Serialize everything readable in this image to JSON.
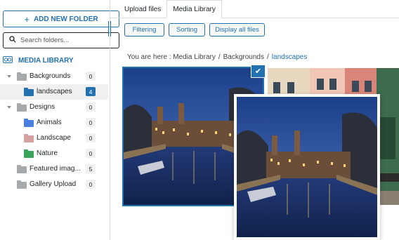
{
  "sidebar": {
    "add_folder_label": "ADD NEW FOLDER",
    "search_placeholder": "Search folders...",
    "library_label": "MEDIA LIBRARY",
    "folders": [
      {
        "label": "Backgrounds",
        "count": "0",
        "color": "#a7aaad"
      },
      {
        "label": "landscapes",
        "count": "4",
        "color": "#2271b1"
      },
      {
        "label": "Designs",
        "count": "0",
        "color": "#a7aaad"
      },
      {
        "label": "Animals",
        "count": "0",
        "color": "#4a7fe0"
      },
      {
        "label": "Landscape",
        "count": "0",
        "color": "#d4a0a0"
      },
      {
        "label": "Nature",
        "count": "0",
        "color": "#3aa35a"
      },
      {
        "label": "Featured imag...",
        "count": "5",
        "color": "#a7aaad"
      },
      {
        "label": "Gallery Upload",
        "count": "0",
        "color": "#a7aaad"
      }
    ]
  },
  "tabs": [
    {
      "label": "Upload files"
    },
    {
      "label": "Media Library"
    }
  ],
  "toolbar": {
    "filtering": "Filtering",
    "sorting": "Sorting",
    "display_all": "Display all files"
  },
  "breadcrumb": {
    "prefix": "You are here :",
    "items": [
      "Media Library",
      "Backgrounds",
      "landscapes"
    ],
    "separator": "/"
  },
  "colors": {
    "accent": "#2271b1"
  },
  "icons": {
    "add": "plus-icon",
    "search": "search-icon",
    "library": "media-library-icon",
    "selected": "checkmark-icon"
  }
}
